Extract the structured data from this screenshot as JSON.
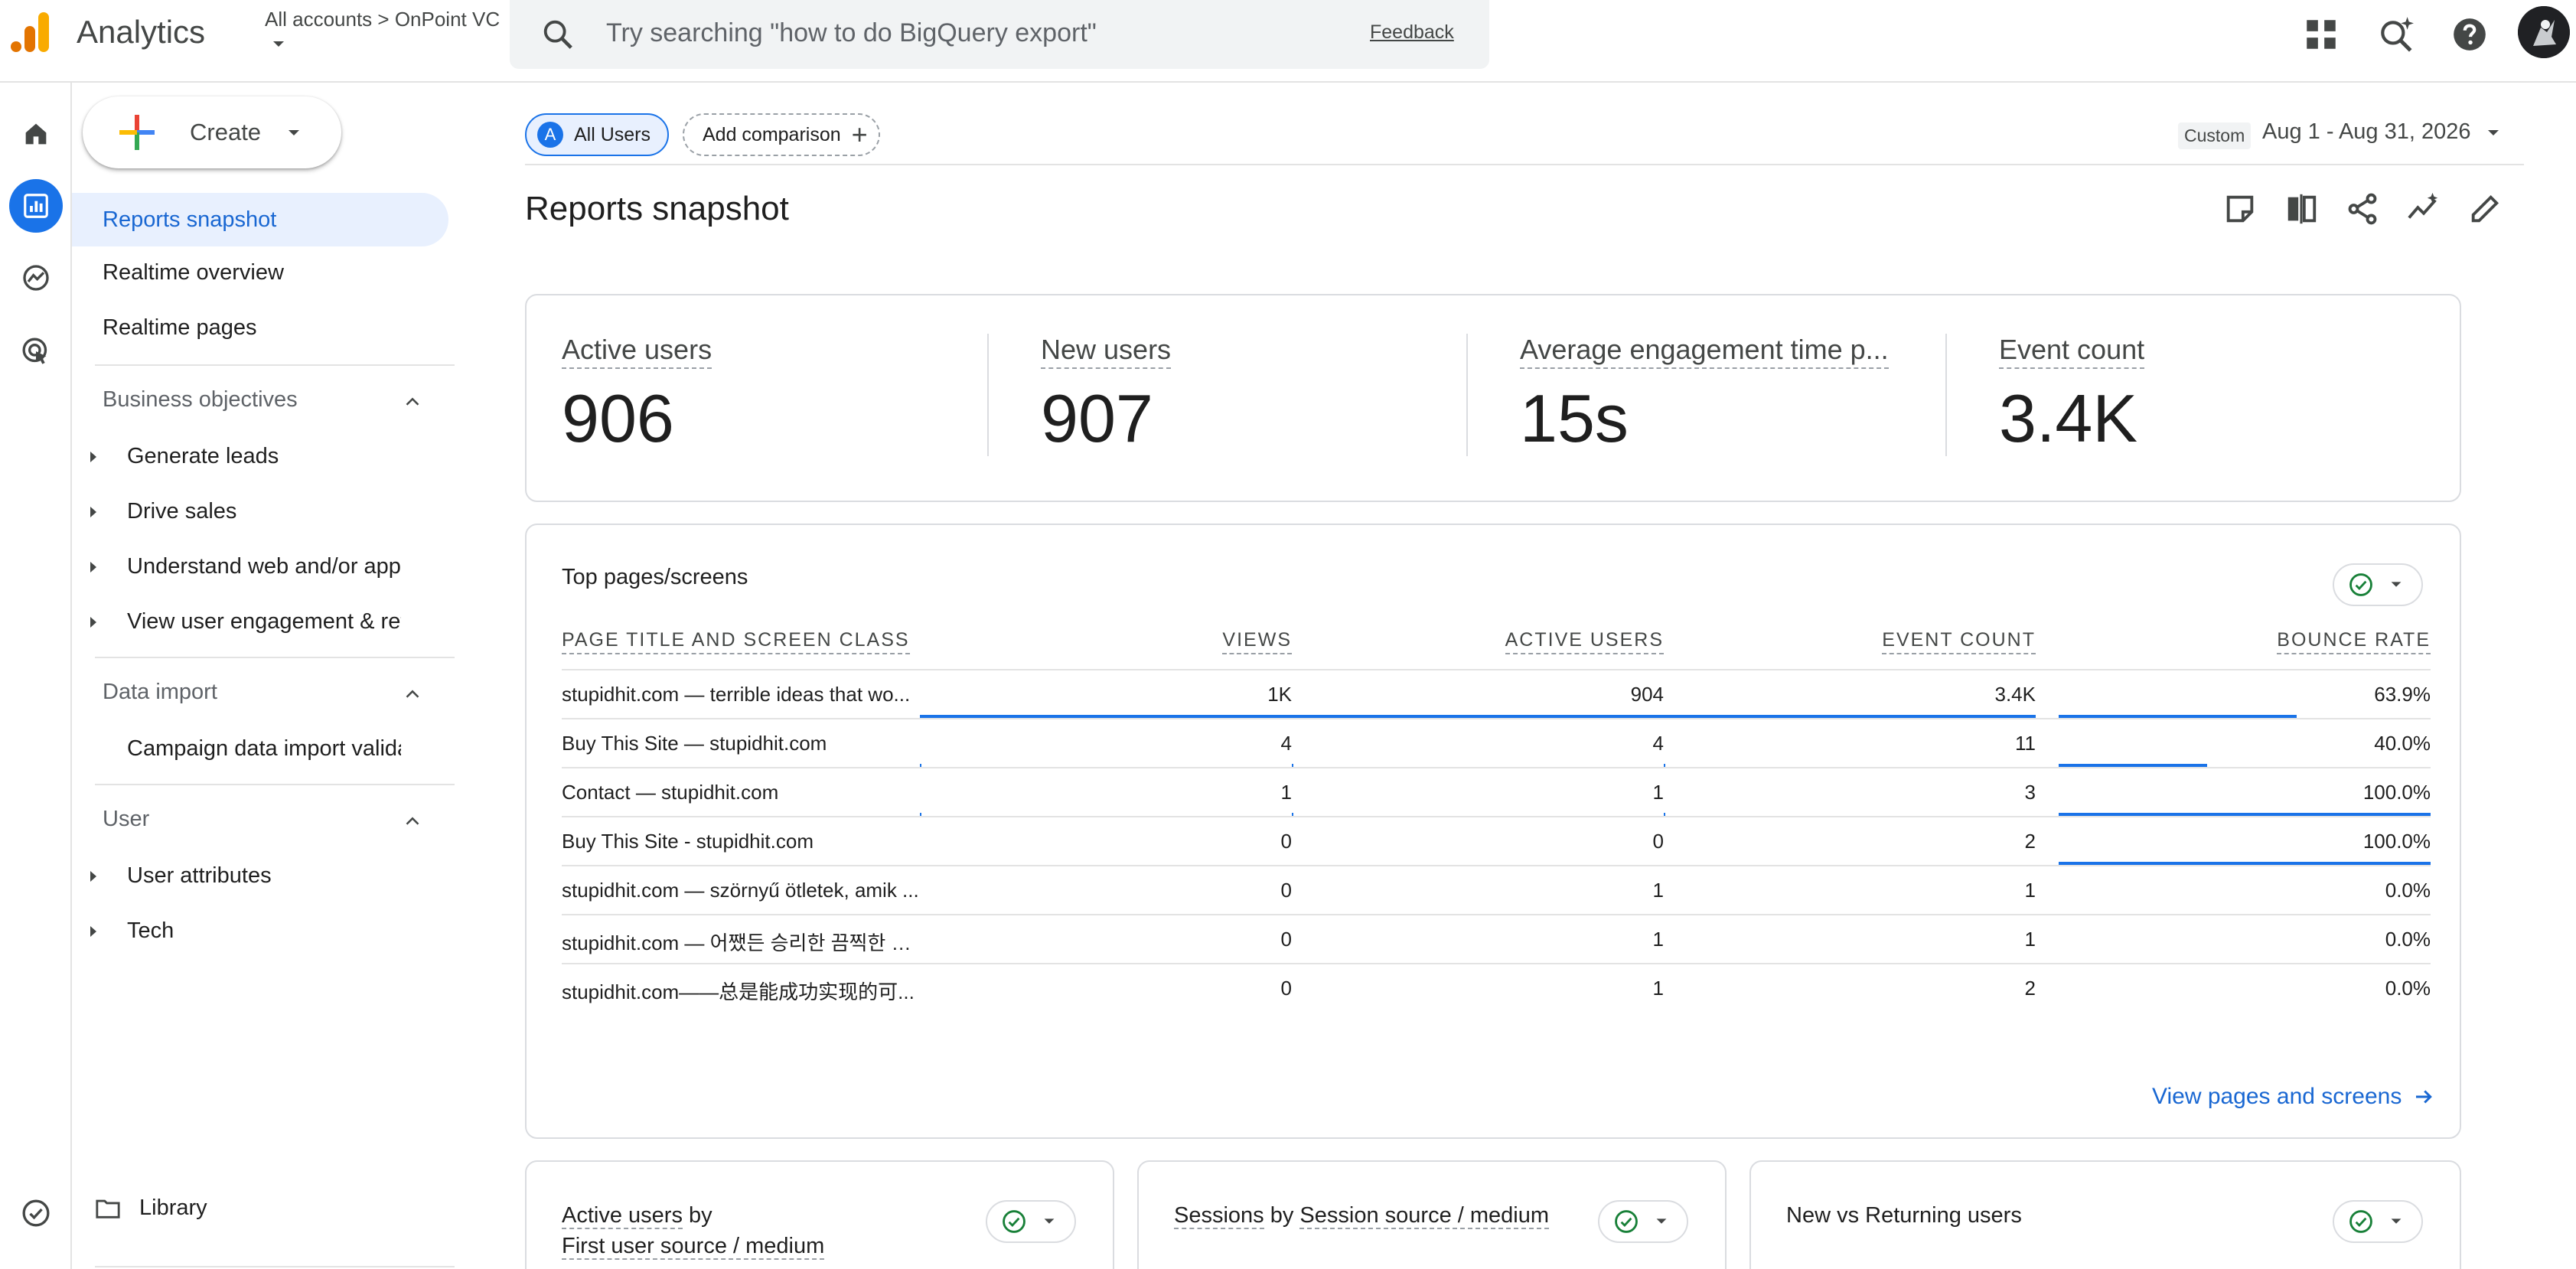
{
  "topbar": {
    "app_name": "Analytics",
    "account_path": "All accounts > OnPoint VC",
    "search_placeholder": "Try searching \"how to do BigQuery export\"",
    "feedback": "Feedback"
  },
  "nav": {
    "create_label": "Create",
    "items": [
      {
        "label": "Reports snapshot",
        "active": true
      },
      {
        "label": "Realtime overview"
      },
      {
        "label": "Realtime pages"
      }
    ],
    "business_objectives": {
      "title": "Business objectives",
      "items": [
        "Generate leads",
        "Drive sales",
        "Understand web and/or app t...",
        "View user engagement & rete..."
      ]
    },
    "data_import": {
      "title": "Data import",
      "items": [
        "Campaign data import valida..."
      ]
    },
    "user": {
      "title": "User",
      "items": [
        "User attributes",
        "Tech"
      ]
    },
    "library": "Library"
  },
  "main": {
    "comparison": {
      "all_users_badge": "A",
      "all_users": "All Users",
      "add_comparison": "Add comparison"
    },
    "date": {
      "custom": "Custom",
      "range": "Aug 1 - Aug 31, 2026"
    },
    "page_title": "Reports snapshot",
    "kpis": [
      {
        "label": "Active users",
        "value": "906"
      },
      {
        "label": "New users",
        "value": "907"
      },
      {
        "label": "Average engagement time p...",
        "value": "15s"
      },
      {
        "label": "Event count",
        "value": "3.4K"
      }
    ],
    "top_pages": {
      "title": "Top pages/screens",
      "columns": [
        "PAGE TITLE AND SCREEN CLASS",
        "VIEWS",
        "ACTIVE USERS",
        "EVENT COUNT",
        "BOUNCE RATE"
      ],
      "rows": [
        {
          "name": "stupidhit.com — terrible ideas that wo...",
          "views": "1K",
          "active_users": "904",
          "event_count": "3.4K",
          "bounce_rate": "63.9%",
          "bars": [
            1.0,
            1.0,
            1.0,
            0.639
          ]
        },
        {
          "name": "Buy This Site — stupidhit.com",
          "views": "4",
          "active_users": "4",
          "event_count": "11",
          "bounce_rate": "40.0%",
          "bars": [
            0.004,
            0.004,
            0.003,
            0.4
          ]
        },
        {
          "name": "Contact — stupidhit.com",
          "views": "1",
          "active_users": "1",
          "event_count": "3",
          "bounce_rate": "100.0%",
          "bars": [
            0.001,
            0.001,
            0.001,
            1.0
          ]
        },
        {
          "name": "Buy This Site - stupidhit.com",
          "views": "0",
          "active_users": "0",
          "event_count": "2",
          "bounce_rate": "100.0%",
          "bars": [
            0,
            0,
            0,
            1.0
          ]
        },
        {
          "name": "stupidhit.com — szörnyű ötletek, amik ...",
          "views": "0",
          "active_users": "1",
          "event_count": "1",
          "bounce_rate": "0.0%",
          "bars": [
            0,
            0,
            0,
            0
          ]
        },
        {
          "name": "stupidhit.com — 어쨌든 승리한 끔찍한 아...",
          "views": "0",
          "active_users": "1",
          "event_count": "1",
          "bounce_rate": "0.0%",
          "bars": [
            0,
            0,
            0,
            0
          ]
        },
        {
          "name": "stupidhit.com——总是能成功实现的可...",
          "views": "0",
          "active_users": "1",
          "event_count": "2",
          "bounce_rate": "0.0%",
          "bars": [
            0,
            0,
            0,
            0
          ]
        }
      ],
      "view_link": "View pages and screens"
    },
    "bottom_cards": [
      {
        "title_a": "Active users",
        "title_mid": " by ",
        "title_b": "First user source / medium"
      },
      {
        "title_a": "Sessions",
        "title_mid": " by ",
        "title_b": "Session source / medium"
      },
      {
        "title_a": "New vs Returning users",
        "title_mid": "",
        "title_b": ""
      }
    ]
  },
  "colors": {
    "accent": "#1a73e8",
    "link": "#1967d2",
    "check": "#188038"
  }
}
